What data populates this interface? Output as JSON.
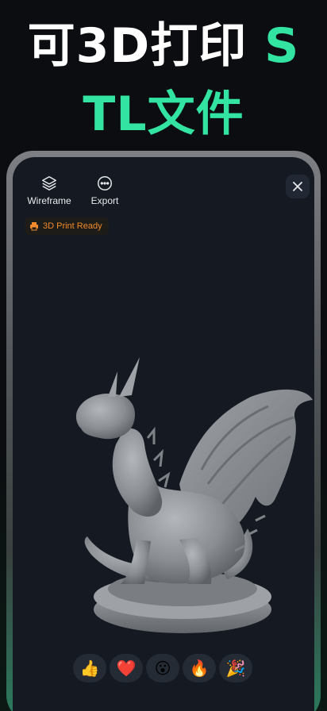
{
  "promo": {
    "headline_line1": "可3D打印 ",
    "headline_line1_accent": "S",
    "headline_line2": "TL文件",
    "accent_color": "#33e3a1"
  },
  "viewer": {
    "toolbar": {
      "wireframe_label": "Wireframe",
      "wireframe_icon": "layers-icon",
      "export_label": "Export",
      "export_icon": "more-circle-icon",
      "close_icon": "close-icon"
    },
    "badge": {
      "label": "3D Print Ready",
      "icon": "printer-icon",
      "color": "#f08a2c"
    },
    "model": {
      "subject": "dragon figurine on round base",
      "color": "#8a8e93"
    },
    "reactions": [
      {
        "emoji": "👍",
        "name": "thumbs-up"
      },
      {
        "emoji": "❤️",
        "name": "heart"
      },
      {
        "emoji": "😮",
        "name": "surprised"
      },
      {
        "emoji": "🔥",
        "name": "fire"
      },
      {
        "emoji": "🎉",
        "name": "party"
      }
    ]
  }
}
